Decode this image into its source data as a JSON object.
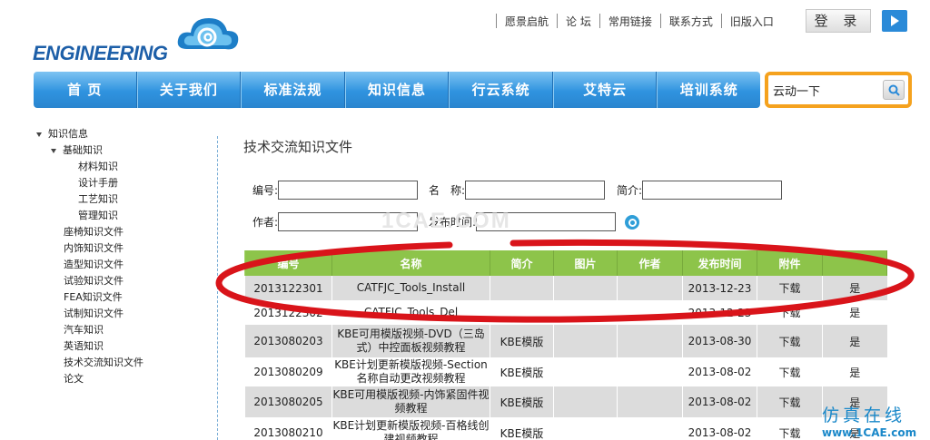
{
  "logo": {
    "text": "ENGINEERING"
  },
  "top_links": [
    "愿景启航",
    "论 坛",
    "常用链接",
    "联系方式",
    "旧版入口"
  ],
  "login": {
    "label": "登 录"
  },
  "main_nav": [
    "首 页",
    "关于我们",
    "标准法规",
    "知识信息",
    "行云系统",
    "艾特云",
    "培训系统"
  ],
  "search": {
    "value": "云动一下"
  },
  "sidebar": {
    "root": "知识信息",
    "group": "基础知识",
    "group_items": [
      "材料知识",
      "设计手册",
      "工艺知识",
      "管理知识"
    ],
    "items": [
      "座椅知识文件",
      "内饰知识文件",
      "造型知识文件",
      "试验知识文件",
      "FEA知识文件",
      "试制知识文件",
      "汽车知识",
      "英语知识",
      "技术交流知识文件",
      "论文"
    ]
  },
  "content": {
    "title": "技术交流知识文件",
    "form": {
      "code_label": "编号:",
      "name_label": "名　称:",
      "intro_label": "简介:",
      "author_label": "作者:",
      "date_label": "发布时间:"
    },
    "watermark": "1CAE.COM",
    "table": {
      "headers": [
        "编号",
        "名称",
        "简介",
        "图片",
        "作者",
        "发布时间",
        "附件",
        ""
      ],
      "rows": [
        {
          "code": "2013122301",
          "name": "CATFJC_Tools_Install",
          "intro": "",
          "pic": "",
          "author": "",
          "date": "2013-12-23",
          "file": "下载",
          "flag": "是"
        },
        {
          "code": "2013122302",
          "name": "CATFJC_Tools_Del",
          "intro": "",
          "pic": "",
          "author": "",
          "date": "2013-12-23",
          "file": "下载",
          "flag": "是"
        },
        {
          "code": "2013080203",
          "name": "KBE可用模版视频-DVD（三岛式）中控面板视频教程",
          "intro": "KBE模版",
          "pic": "",
          "author": "",
          "date": "2013-08-30",
          "file": "下载",
          "flag": "是"
        },
        {
          "code": "2013080209",
          "name": "KBE计划更新模版视频-Section名称自动更改视频教程",
          "intro": "KBE模版",
          "pic": "",
          "author": "",
          "date": "2013-08-02",
          "file": "下载",
          "flag": "是"
        },
        {
          "code": "2013080205",
          "name": "KBE可用模版视频-内饰紧固件视频教程",
          "intro": "KBE模版",
          "pic": "",
          "author": "",
          "date": "2013-08-02",
          "file": "下载",
          "flag": "是"
        },
        {
          "code": "2013080210",
          "name": "KBE计划更新模版视频-百格线创建视频教程",
          "intro": "KBE模版",
          "pic": "",
          "author": "",
          "date": "2013-08-02",
          "file": "下载",
          "flag": "是"
        }
      ]
    }
  },
  "corner_watermark": {
    "cn": "仿真在线",
    "url": "www.1CAE.com"
  },
  "colors": {
    "nav_blue": "#2f93df",
    "table_header_green": "#8dc44a",
    "search_border_orange": "#f5a21e",
    "highlight_red": "#d9141a"
  }
}
